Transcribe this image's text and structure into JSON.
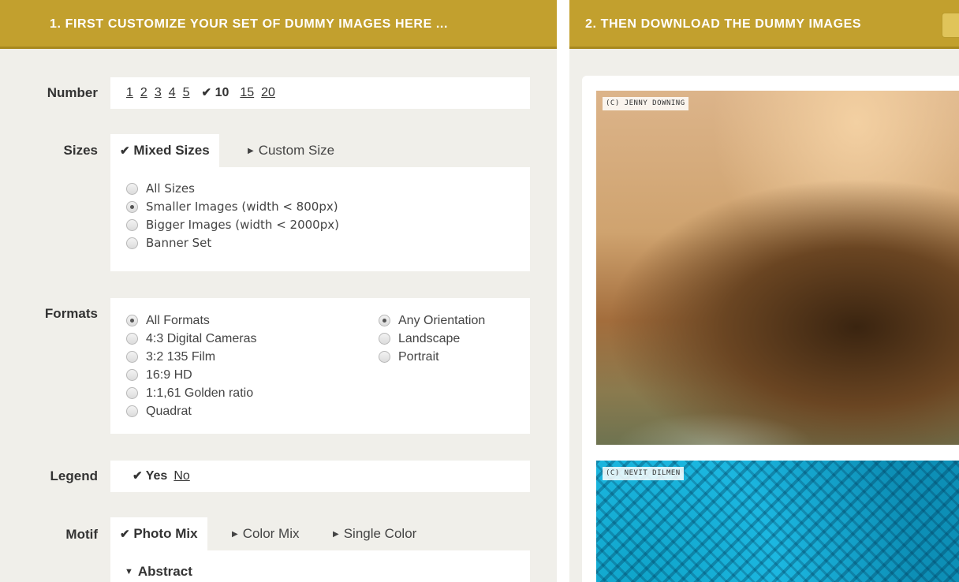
{
  "left_header": "1. FIRST CUSTOMIZE YOUR SET OF DUMMY IMAGES HERE ...",
  "right_header": "2. THEN DOWNLOAD THE DUMMY IMAGES",
  "number": {
    "label": "Number",
    "options": [
      "1",
      "2",
      "3",
      "4",
      "5"
    ],
    "selected": "10",
    "options_after": [
      "15",
      "20"
    ]
  },
  "sizes": {
    "label": "Sizes",
    "tabs": [
      {
        "label": "Mixed Sizes",
        "active": true
      },
      {
        "label": "Custom Size",
        "active": false
      }
    ],
    "options": [
      "All Sizes",
      "Smaller Images (width < 800px)",
      "Bigger Images (width < 2000px)",
      "Banner Set"
    ],
    "selected_index": 1
  },
  "formats": {
    "label": "Formats",
    "options": [
      "All Formats",
      "4:3 Digital Cameras",
      "3:2 135 Film",
      "16:9 HD",
      "1:1,61 Golden ratio",
      "Quadrat"
    ],
    "selected_index": 0,
    "orientation_options": [
      "Any Orientation",
      "Landscape",
      "Portrait"
    ],
    "orientation_selected_index": 0
  },
  "legend": {
    "label": "Legend",
    "selected": "Yes",
    "other": "No"
  },
  "motif": {
    "label": "Motif",
    "tabs": [
      {
        "label": "Photo Mix",
        "active": true
      },
      {
        "label": "Color Mix",
        "active": false
      },
      {
        "label": "Single Color",
        "active": false
      }
    ],
    "category": "Abstract"
  },
  "previews": [
    {
      "caption": "(C) JENNY DOWNING"
    },
    {
      "caption": "(C) NEVIT DILMEN"
    }
  ],
  "icons": {
    "check": "✔",
    "triangle_right": "▶",
    "triangle_down": "▼"
  },
  "colors": {
    "header_gold": "#c2a02e",
    "panel_bg": "#f0efea"
  }
}
